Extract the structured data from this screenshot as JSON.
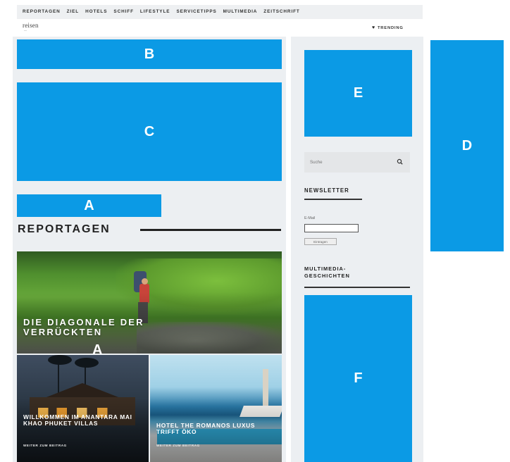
{
  "nav": {
    "items": [
      "REPORTAGEN",
      "ZIEL",
      "HOTELS",
      "SCHIFF",
      "LIFESTYLE",
      "SERVICETIPPS",
      "MULTIMEDIA",
      "ZEITSCHRIFT"
    ]
  },
  "header": {
    "logo": "reisen",
    "trending": "TRENDING"
  },
  "placeholders": {
    "a_top": "A",
    "b": "B",
    "c": "C",
    "d": "D",
    "e": "E",
    "f": "F",
    "a_tile": "A"
  },
  "main": {
    "section_title": "REPORTAGEN",
    "articles": [
      {
        "title": "DIE DIAGONALE DER VERRÜCKTEN"
      },
      {
        "title": "WILLKOMMEN IM ANANTARA MAI KHAO PHUKET VILLAS",
        "more": "WEITER ZUM BEITRAG"
      },
      {
        "title": "HOTEL THE ROMANOS LUXUS TRIFFT ÖKO",
        "more": "WEITER ZUM BEITRAG"
      }
    ]
  },
  "sidebar": {
    "search_placeholder": "Suche",
    "newsletter_title": "NEWSLETTER",
    "email_label": "E-Mail",
    "submit_label": "Eintragen",
    "multimedia_title": "MULTIMEDIA-GESCHICHTEN"
  },
  "colors": {
    "placeholder_blue": "#0b9ae5",
    "page_gray": "#eceff2"
  }
}
